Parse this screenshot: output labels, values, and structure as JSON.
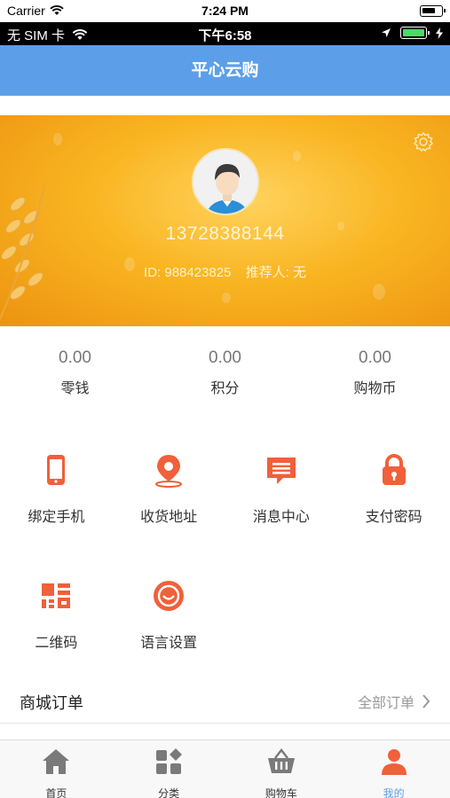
{
  "ios_status": {
    "carrier": "Carrier",
    "time": "7:24 PM"
  },
  "system_status": {
    "carrier": "无 SIM 卡",
    "time": "下午6:58"
  },
  "header": {
    "title": "平心云购"
  },
  "profile": {
    "phone": "13728388144",
    "id_text": "ID: 988423825",
    "referrer_text": "推荐人: 无"
  },
  "wallet": [
    {
      "value": "0.00",
      "label": "零钱"
    },
    {
      "value": "0.00",
      "label": "积分"
    },
    {
      "value": "0.00",
      "label": "购物币"
    }
  ],
  "functions": [
    {
      "label": "绑定手机",
      "icon": "phone-icon"
    },
    {
      "label": "收货地址",
      "icon": "location-pin-icon"
    },
    {
      "label": "消息中心",
      "icon": "message-icon"
    },
    {
      "label": "支付密码",
      "icon": "lock-icon"
    },
    {
      "label": "二维码",
      "icon": "qr-code-icon"
    },
    {
      "label": "语言设置",
      "icon": "language-icon"
    }
  ],
  "orders": {
    "title": "商城订单",
    "all_label": "全部订单"
  },
  "tabbar": [
    {
      "label": "首页",
      "icon": "home-icon"
    },
    {
      "label": "分类",
      "icon": "category-icon"
    },
    {
      "label": "购物车",
      "icon": "cart-icon"
    },
    {
      "label": "我的",
      "icon": "user-icon"
    }
  ],
  "colors": {
    "accent": "#5c9fe8",
    "icon_orange": "#f0603a",
    "tab_icon_gray": "#7a7a7a"
  }
}
